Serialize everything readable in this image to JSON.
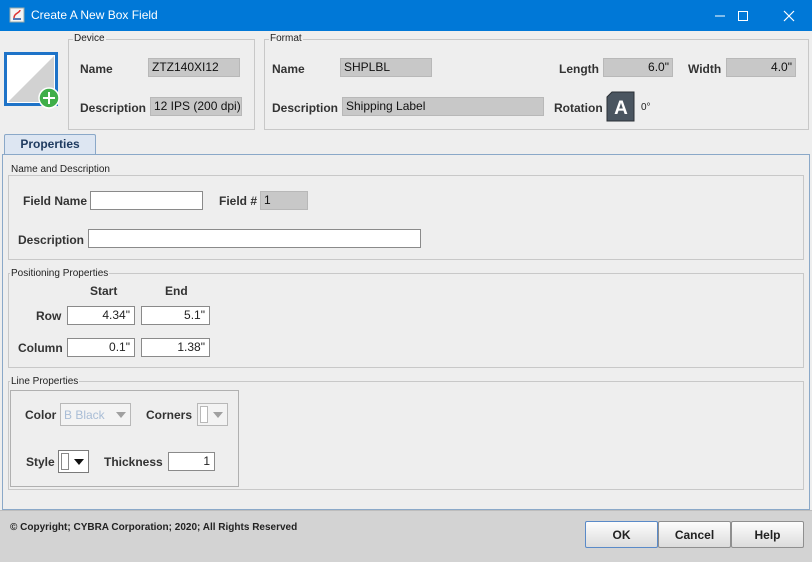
{
  "window": {
    "title": "Create A New Box Field",
    "minimize_icon": "minimize-icon",
    "maximize_icon": "maximize-icon",
    "close_icon": "close-icon"
  },
  "device": {
    "group_label": "Device",
    "name_label": "Name",
    "name_value": "ZTZ140XI12",
    "description_label": "Description",
    "description_value": "12 IPS (200 dpi)"
  },
  "format": {
    "group_label": "Format",
    "name_label": "Name",
    "name_value": "SHPLBL",
    "description_label": "Description",
    "description_value": "Shipping Label",
    "length_label": "Length",
    "length_value": "6.0\"",
    "width_label": "Width",
    "width_value": "4.0\"",
    "rotation_label": "Rotation",
    "rotation_glyph": "A",
    "rotation_value": "0°"
  },
  "tabs": [
    {
      "label": "Properties"
    }
  ],
  "name_description": {
    "group_label": "Name and Description",
    "field_name_label": "Field Name",
    "field_name_value": "",
    "field_num_label": "Field #",
    "field_num_value": "1",
    "description_label": "Description",
    "description_value": ""
  },
  "positioning": {
    "group_label": "Positioning Properties",
    "start_header": "Start",
    "end_header": "End",
    "row_label": "Row",
    "row_start": "4.34\"",
    "row_end": "5.1\"",
    "column_label": "Column",
    "column_start": "0.1\"",
    "column_end": "1.38\""
  },
  "line": {
    "group_label": "Line Properties",
    "color_label": "Color",
    "color_value": "B Black",
    "corners_label": "Corners",
    "corners_value": "",
    "style_label": "Style",
    "style_value": "",
    "thickness_label": "Thickness",
    "thickness_value": "1"
  },
  "footer": {
    "copyright": "© Copyright; CYBRA Corporation; 2020; All Rights Reserved",
    "ok_label": "OK",
    "cancel_label": "Cancel",
    "help_label": "Help"
  },
  "colors": {
    "titlebar": "#0078d7",
    "add_badge": "#3fae49",
    "preview_border": "#1e73c8"
  }
}
